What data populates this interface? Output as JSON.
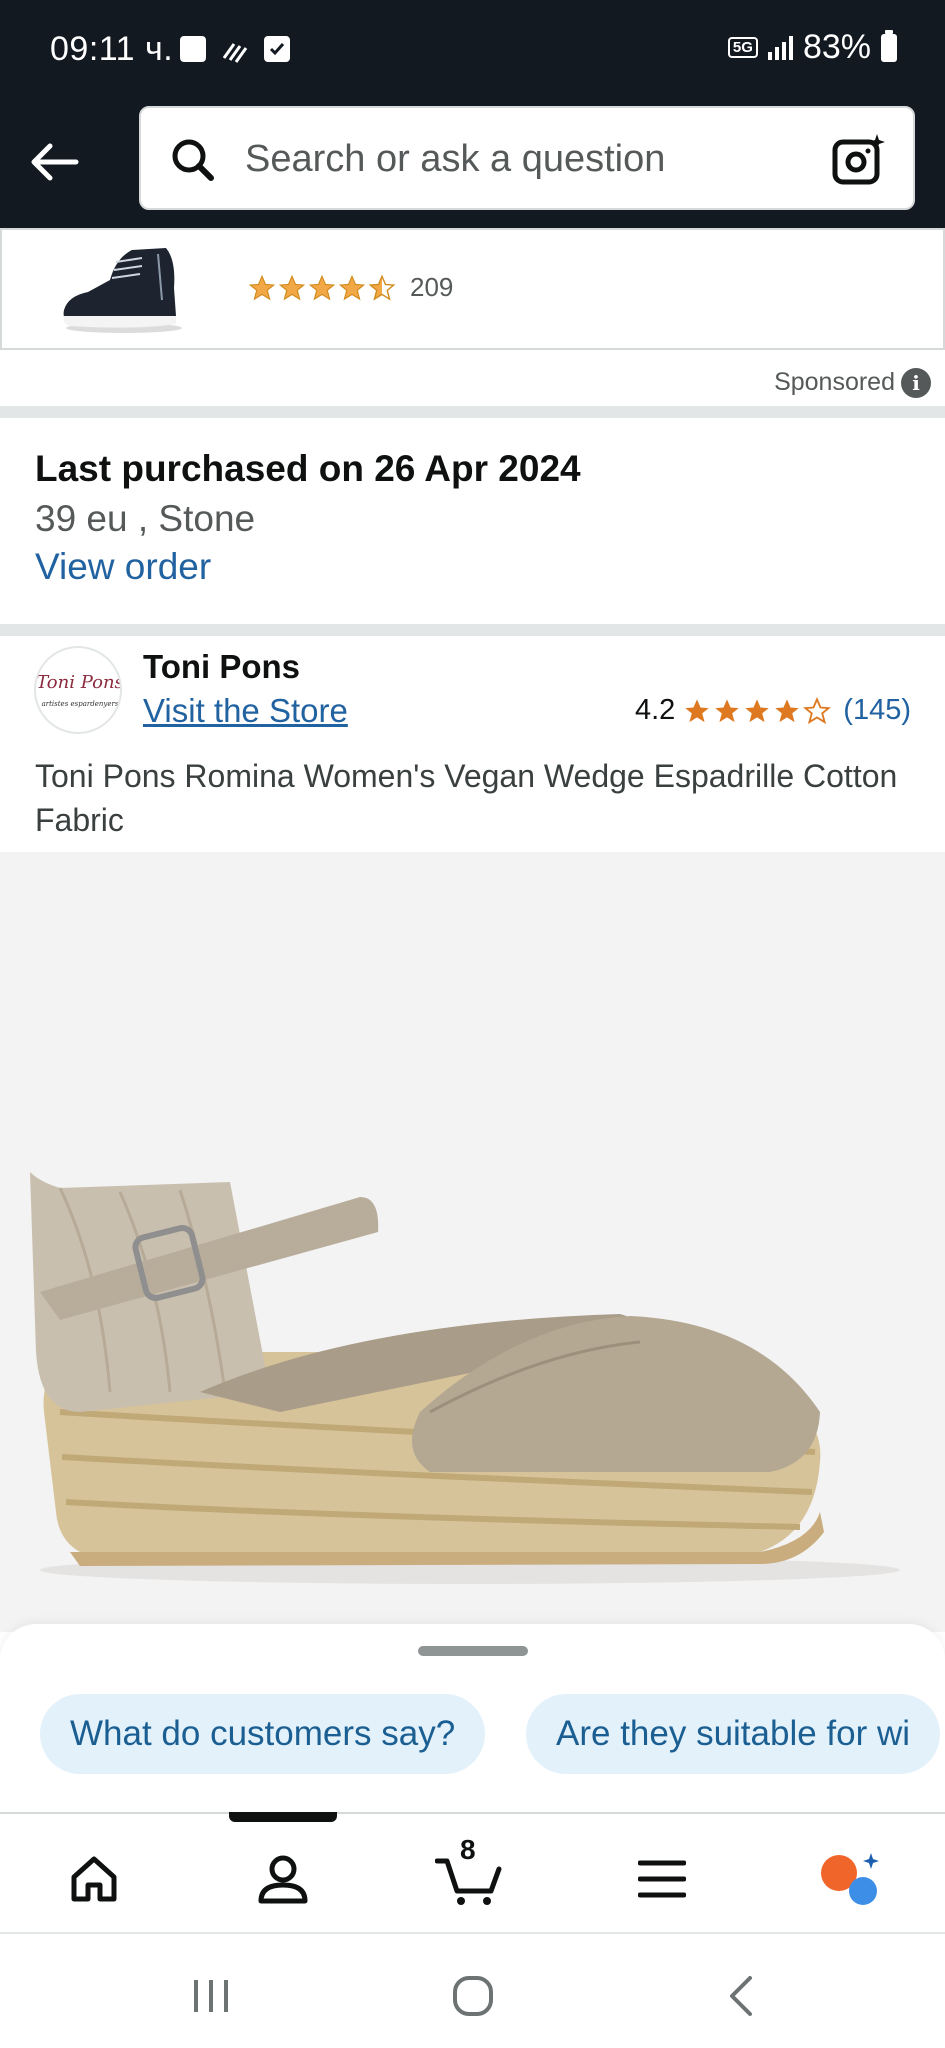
{
  "status_bar": {
    "time": "09:11 ч.",
    "network": "5G",
    "battery": "83%"
  },
  "search": {
    "placeholder": "Search or ask a question"
  },
  "sponsored_product": {
    "rating": 4.5,
    "review_count": "209"
  },
  "sponsored_label": "Sponsored",
  "last_purchased": {
    "title": "Last purchased on 26 Apr 2024",
    "variant": "39 eu , Stone",
    "link": "View order"
  },
  "brand": {
    "logo_text": "Toni Pons",
    "logo_subtext": "artistes espardenyers",
    "name": "Toni Pons",
    "store_link": "Visit the Store",
    "rating_value": "4.2",
    "rating": 4.2,
    "rating_count": "(145)"
  },
  "product": {
    "title": "Toni Pons Romina Women's Vegan Wedge Espadrille Cotton Fabric"
  },
  "suggestions": [
    "What do customers say?",
    "Are they suitable for wi"
  ],
  "bottom_nav": {
    "cart_count": "8",
    "items": [
      "home-icon",
      "account-icon",
      "cart-icon",
      "menu-icon",
      "rufus-icon"
    ]
  },
  "colors": {
    "header_bg": "#131921",
    "link": "#2162a1",
    "star": "#f3a847",
    "chip_bg": "#e3f1fb",
    "chip_text": "#1b5f92"
  }
}
